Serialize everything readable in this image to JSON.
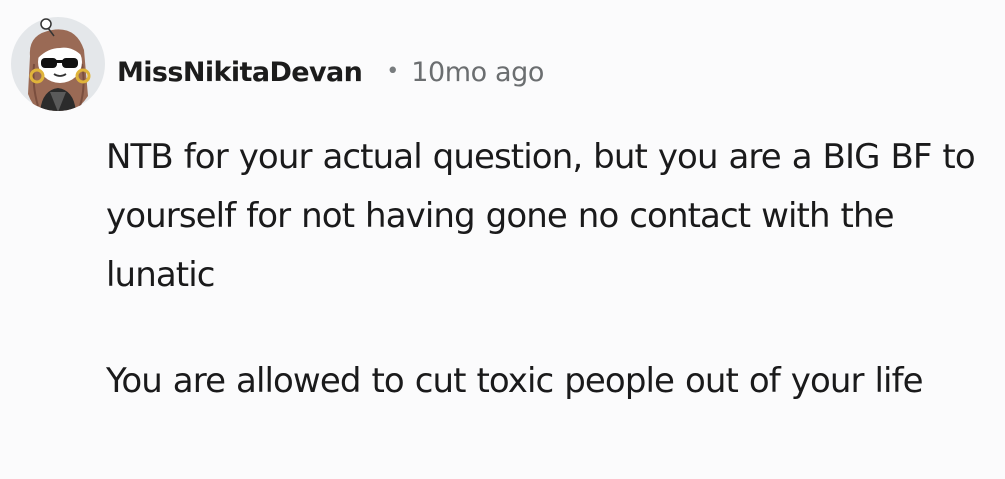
{
  "comment": {
    "author": "MissNikitaDevan",
    "separator": "•",
    "timestamp": "10mo ago",
    "paragraphs": [
      "NTB for your actual question, but you are a BIG BF to yourself for not having gone no contact with the lunatic",
      "You are allowed to cut toxic people out of your life"
    ]
  },
  "colors": {
    "background": "#fbfbfc",
    "text": "#1a1a1b",
    "meta": "#6b6e70",
    "avatar_bg": "#e4e7ea"
  }
}
